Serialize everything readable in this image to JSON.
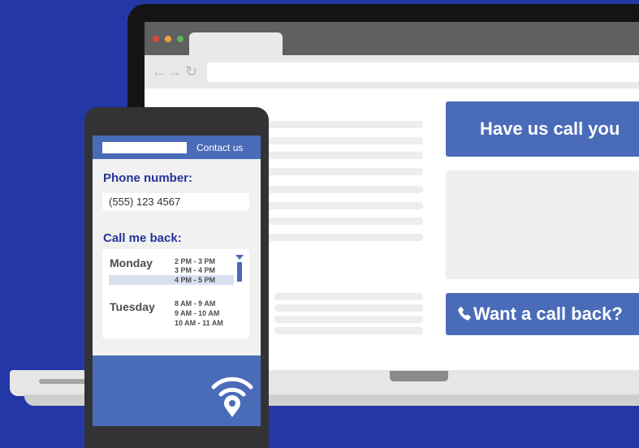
{
  "browser": {
    "nav_back": "←",
    "nav_forward": "→",
    "nav_reload": "↻",
    "cta_top_label": "Have us call you",
    "cta_bottom_label": "Want a call back?",
    "cta_bottom_icon": "phone-icon"
  },
  "phone": {
    "contact_label": "Contact us",
    "phone_label": "Phone number:",
    "phone_value": "(555) 123 4567",
    "callback_label": "Call me back:",
    "schedule": [
      {
        "day": "Monday",
        "slots": [
          "2 PM - 3 PM",
          "3 PM - 4 PM",
          "4 PM - 5 PM"
        ]
      },
      {
        "day": "Tuesday",
        "slots": [
          "8 AM - 9 AM",
          "9 AM - 10 AM",
          "10 AM - 11 AM"
        ]
      }
    ],
    "footer_icon": "wifi-location-icon"
  },
  "colors": {
    "background": "#2437a6",
    "accent": "#4a6bb8",
    "label": "#26349a"
  }
}
